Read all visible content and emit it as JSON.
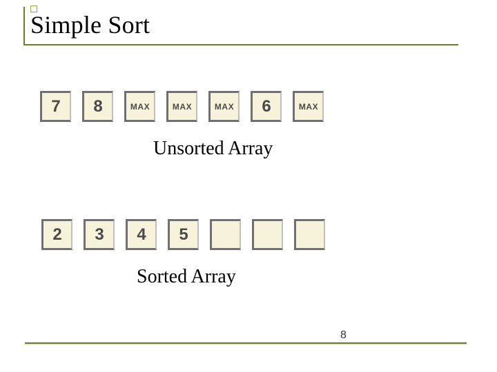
{
  "title": "Simple Sort",
  "unsorted": {
    "caption": "Unsorted Array",
    "cells": [
      {
        "kind": "num",
        "text": "7"
      },
      {
        "kind": "num",
        "text": "8"
      },
      {
        "kind": "max",
        "text": "MAX"
      },
      {
        "kind": "max",
        "text": "MAX"
      },
      {
        "kind": "max",
        "text": "MAX"
      },
      {
        "kind": "num",
        "text": "6"
      },
      {
        "kind": "max",
        "text": "MAX"
      }
    ]
  },
  "sorted": {
    "caption": "Sorted Array",
    "cells": [
      {
        "kind": "num",
        "text": "2"
      },
      {
        "kind": "num",
        "text": "3"
      },
      {
        "kind": "num",
        "text": "4"
      },
      {
        "kind": "num",
        "text": "5"
      },
      {
        "kind": "blank",
        "text": ""
      },
      {
        "kind": "blank",
        "text": ""
      },
      {
        "kind": "blank",
        "text": ""
      }
    ]
  },
  "page": "8",
  "chart_data": {
    "type": "table",
    "title": "Simple Sort",
    "series": [
      {
        "name": "Unsorted Array",
        "values": [
          "7",
          "8",
          "MAX",
          "MAX",
          "MAX",
          "6",
          "MAX"
        ]
      },
      {
        "name": "Sorted Array",
        "values": [
          "2",
          "3",
          "4",
          "5",
          "",
          "",
          ""
        ]
      }
    ]
  }
}
